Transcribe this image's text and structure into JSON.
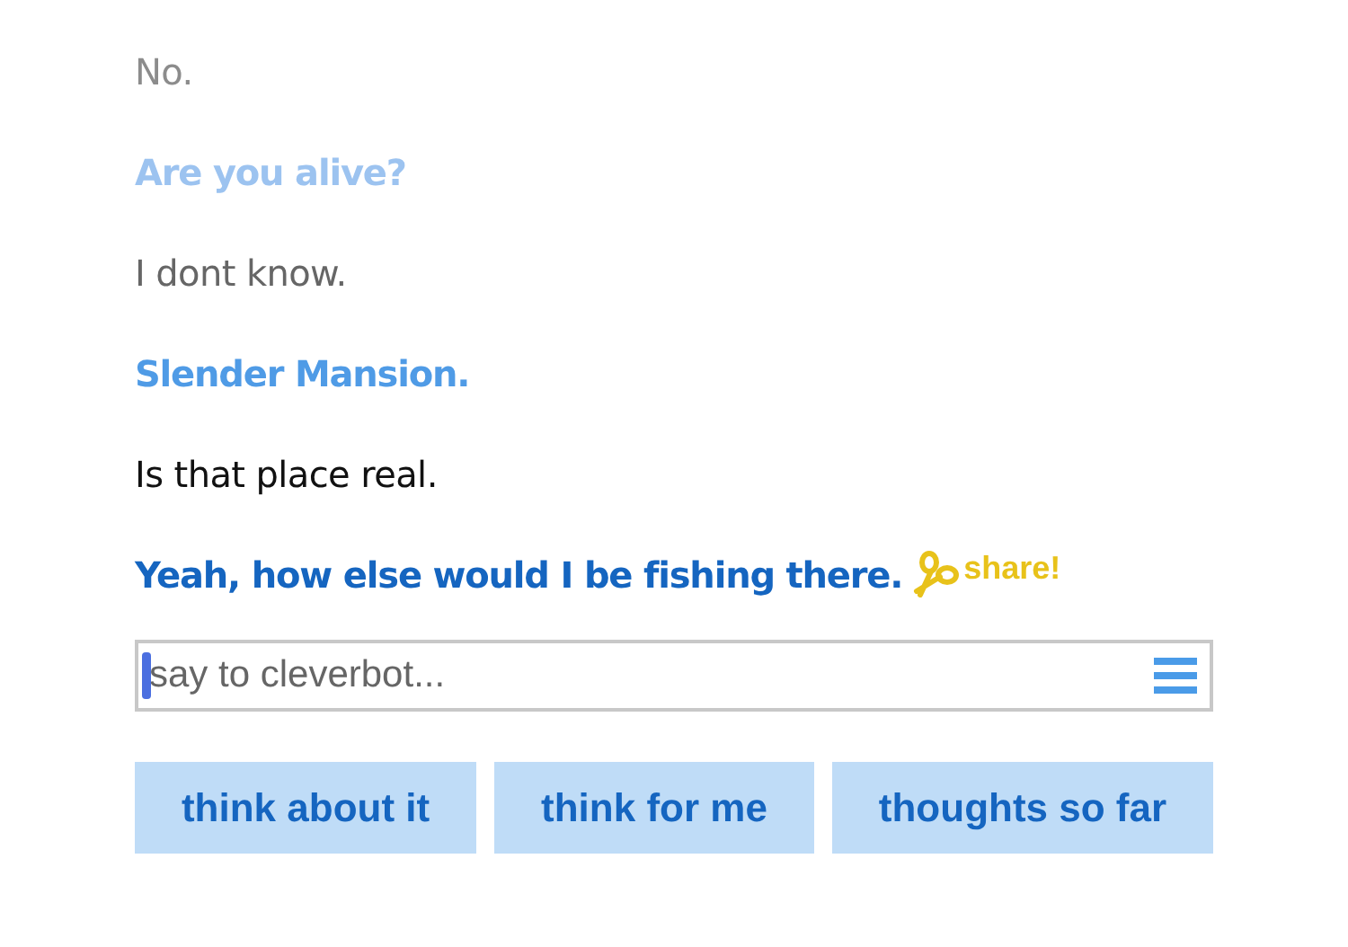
{
  "messages": [
    {
      "kind": "bot",
      "text": "No.",
      "color": "#8c8c8c"
    },
    {
      "kind": "user",
      "text": "Are you alive?",
      "color": "#9cc3f0"
    },
    {
      "kind": "bot",
      "text": "I dont know.",
      "color": "#666666"
    },
    {
      "kind": "user",
      "text": "Slender Mansion.",
      "color": "#4f9be6"
    },
    {
      "kind": "bot",
      "text": "Is that place real.",
      "color": "#111111"
    },
    {
      "kind": "user",
      "text": "Yeah, how else would I be fishing there.",
      "color": "#1565c0"
    }
  ],
  "share": {
    "label": "share!"
  },
  "input": {
    "placeholder": "say to cleverbot..."
  },
  "buttons": [
    "think about it",
    "think for me",
    "thoughts so far"
  ]
}
